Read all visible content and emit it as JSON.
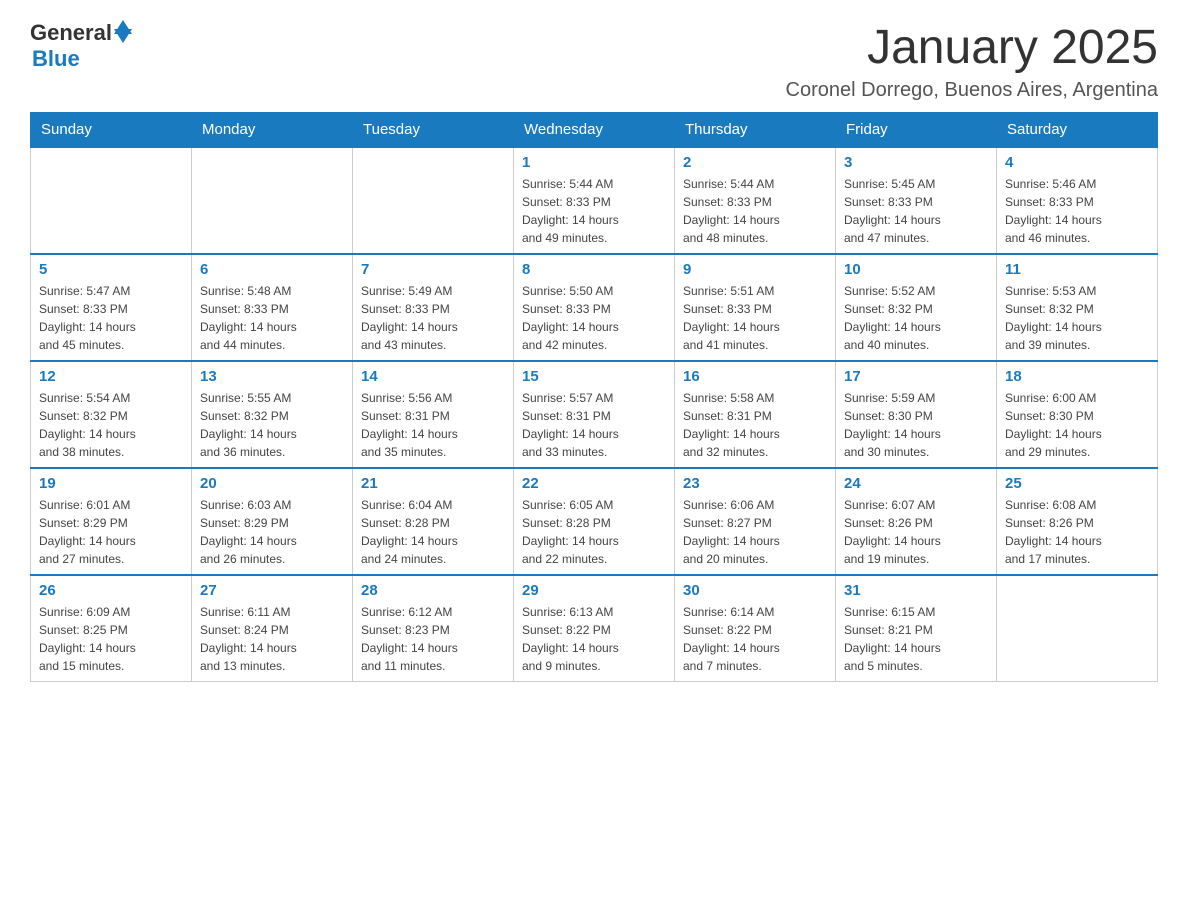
{
  "header": {
    "logo_general": "General",
    "logo_blue": "Blue",
    "title": "January 2025",
    "location": "Coronel Dorrego, Buenos Aires, Argentina"
  },
  "calendar": {
    "days_of_week": [
      "Sunday",
      "Monday",
      "Tuesday",
      "Wednesday",
      "Thursday",
      "Friday",
      "Saturday"
    ],
    "weeks": [
      [
        {
          "day": "",
          "info": ""
        },
        {
          "day": "",
          "info": ""
        },
        {
          "day": "",
          "info": ""
        },
        {
          "day": "1",
          "info": "Sunrise: 5:44 AM\nSunset: 8:33 PM\nDaylight: 14 hours\nand 49 minutes."
        },
        {
          "day": "2",
          "info": "Sunrise: 5:44 AM\nSunset: 8:33 PM\nDaylight: 14 hours\nand 48 minutes."
        },
        {
          "day": "3",
          "info": "Sunrise: 5:45 AM\nSunset: 8:33 PM\nDaylight: 14 hours\nand 47 minutes."
        },
        {
          "day": "4",
          "info": "Sunrise: 5:46 AM\nSunset: 8:33 PM\nDaylight: 14 hours\nand 46 minutes."
        }
      ],
      [
        {
          "day": "5",
          "info": "Sunrise: 5:47 AM\nSunset: 8:33 PM\nDaylight: 14 hours\nand 45 minutes."
        },
        {
          "day": "6",
          "info": "Sunrise: 5:48 AM\nSunset: 8:33 PM\nDaylight: 14 hours\nand 44 minutes."
        },
        {
          "day": "7",
          "info": "Sunrise: 5:49 AM\nSunset: 8:33 PM\nDaylight: 14 hours\nand 43 minutes."
        },
        {
          "day": "8",
          "info": "Sunrise: 5:50 AM\nSunset: 8:33 PM\nDaylight: 14 hours\nand 42 minutes."
        },
        {
          "day": "9",
          "info": "Sunrise: 5:51 AM\nSunset: 8:33 PM\nDaylight: 14 hours\nand 41 minutes."
        },
        {
          "day": "10",
          "info": "Sunrise: 5:52 AM\nSunset: 8:32 PM\nDaylight: 14 hours\nand 40 minutes."
        },
        {
          "day": "11",
          "info": "Sunrise: 5:53 AM\nSunset: 8:32 PM\nDaylight: 14 hours\nand 39 minutes."
        }
      ],
      [
        {
          "day": "12",
          "info": "Sunrise: 5:54 AM\nSunset: 8:32 PM\nDaylight: 14 hours\nand 38 minutes."
        },
        {
          "day": "13",
          "info": "Sunrise: 5:55 AM\nSunset: 8:32 PM\nDaylight: 14 hours\nand 36 minutes."
        },
        {
          "day": "14",
          "info": "Sunrise: 5:56 AM\nSunset: 8:31 PM\nDaylight: 14 hours\nand 35 minutes."
        },
        {
          "day": "15",
          "info": "Sunrise: 5:57 AM\nSunset: 8:31 PM\nDaylight: 14 hours\nand 33 minutes."
        },
        {
          "day": "16",
          "info": "Sunrise: 5:58 AM\nSunset: 8:31 PM\nDaylight: 14 hours\nand 32 minutes."
        },
        {
          "day": "17",
          "info": "Sunrise: 5:59 AM\nSunset: 8:30 PM\nDaylight: 14 hours\nand 30 minutes."
        },
        {
          "day": "18",
          "info": "Sunrise: 6:00 AM\nSunset: 8:30 PM\nDaylight: 14 hours\nand 29 minutes."
        }
      ],
      [
        {
          "day": "19",
          "info": "Sunrise: 6:01 AM\nSunset: 8:29 PM\nDaylight: 14 hours\nand 27 minutes."
        },
        {
          "day": "20",
          "info": "Sunrise: 6:03 AM\nSunset: 8:29 PM\nDaylight: 14 hours\nand 26 minutes."
        },
        {
          "day": "21",
          "info": "Sunrise: 6:04 AM\nSunset: 8:28 PM\nDaylight: 14 hours\nand 24 minutes."
        },
        {
          "day": "22",
          "info": "Sunrise: 6:05 AM\nSunset: 8:28 PM\nDaylight: 14 hours\nand 22 minutes."
        },
        {
          "day": "23",
          "info": "Sunrise: 6:06 AM\nSunset: 8:27 PM\nDaylight: 14 hours\nand 20 minutes."
        },
        {
          "day": "24",
          "info": "Sunrise: 6:07 AM\nSunset: 8:26 PM\nDaylight: 14 hours\nand 19 minutes."
        },
        {
          "day": "25",
          "info": "Sunrise: 6:08 AM\nSunset: 8:26 PM\nDaylight: 14 hours\nand 17 minutes."
        }
      ],
      [
        {
          "day": "26",
          "info": "Sunrise: 6:09 AM\nSunset: 8:25 PM\nDaylight: 14 hours\nand 15 minutes."
        },
        {
          "day": "27",
          "info": "Sunrise: 6:11 AM\nSunset: 8:24 PM\nDaylight: 14 hours\nand 13 minutes."
        },
        {
          "day": "28",
          "info": "Sunrise: 6:12 AM\nSunset: 8:23 PM\nDaylight: 14 hours\nand 11 minutes."
        },
        {
          "day": "29",
          "info": "Sunrise: 6:13 AM\nSunset: 8:22 PM\nDaylight: 14 hours\nand 9 minutes."
        },
        {
          "day": "30",
          "info": "Sunrise: 6:14 AM\nSunset: 8:22 PM\nDaylight: 14 hours\nand 7 minutes."
        },
        {
          "day": "31",
          "info": "Sunrise: 6:15 AM\nSunset: 8:21 PM\nDaylight: 14 hours\nand 5 minutes."
        },
        {
          "day": "",
          "info": ""
        }
      ]
    ]
  }
}
